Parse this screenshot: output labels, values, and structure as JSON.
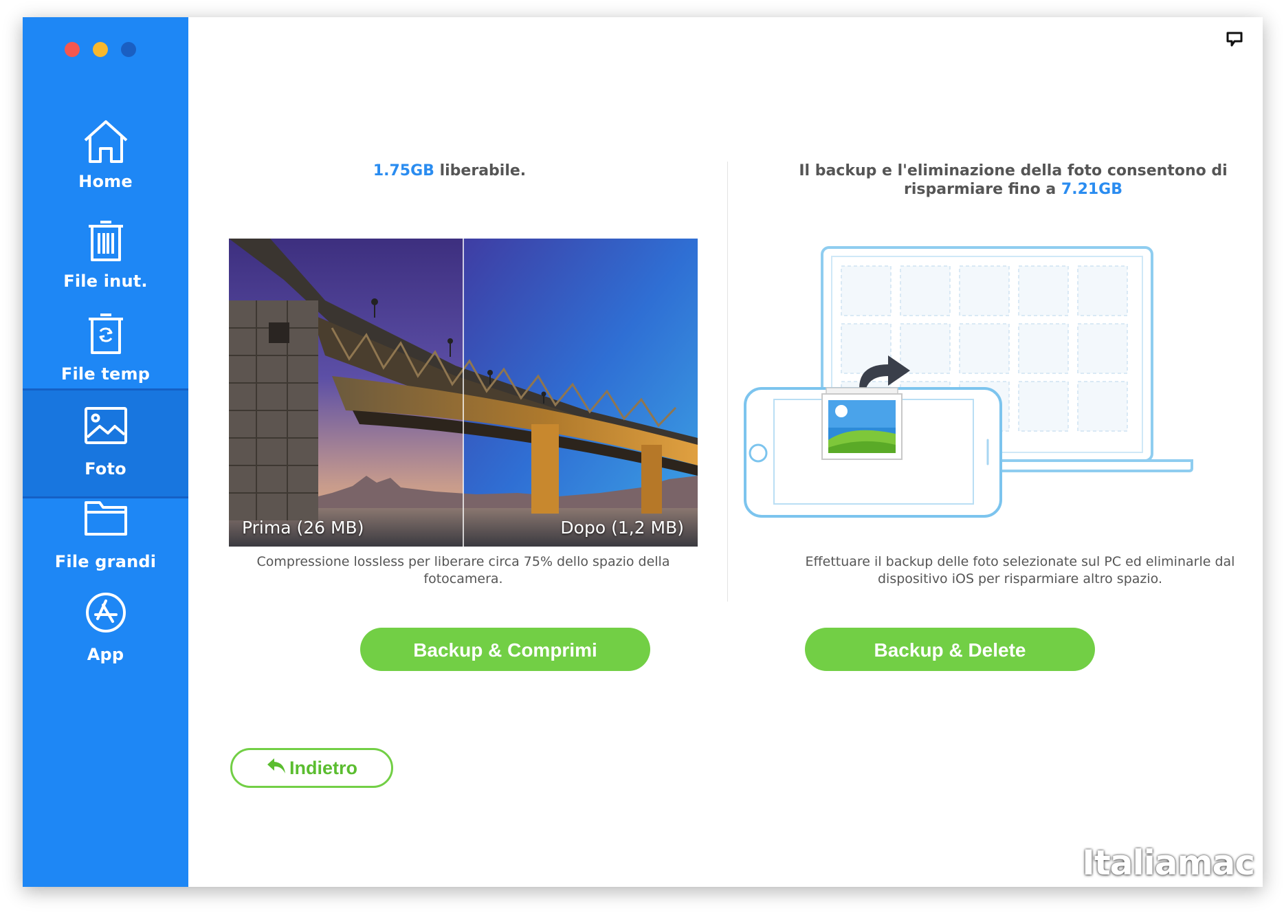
{
  "sidebar": {
    "items": [
      {
        "label": "Home",
        "icon": "home-icon",
        "active": false
      },
      {
        "label": "File inut.",
        "icon": "trash-icon",
        "active": false
      },
      {
        "label": "File temp",
        "icon": "temp-trash-icon",
        "active": false
      },
      {
        "label": "Foto",
        "icon": "photo-icon",
        "active": true
      },
      {
        "label": "File grandi",
        "icon": "folder-icon",
        "active": false
      },
      {
        "label": "App",
        "icon": "app-store-icon",
        "active": false
      }
    ]
  },
  "compress": {
    "amount": "1.75GB",
    "amount_suffix": " liberabile.",
    "before_label": "Prima (26 MB)",
    "after_label": "Dopo (1,2 MB)",
    "description": "Compressione lossless per liberare circa 75% dello spazio della fotocamera.",
    "button_label": "Backup & Comprimi"
  },
  "delete": {
    "heading_prefix": "Il backup e l'eliminazione della foto consentono di risparmiare fino a ",
    "amount": "7.21GB",
    "description": "Effettuare il backup delle foto selezionate sul PC ed eliminarle dal dispositivo iOS per risparmiare altro spazio.",
    "button_label": "Backup & Delete"
  },
  "back_label": "Indietro",
  "watermark": "Italiamac",
  "colors": {
    "sidebar": "#1e87f5",
    "sidebar_active": "#1876df",
    "accent_blue": "#2a8cf0",
    "button_green": "#72cf45"
  }
}
